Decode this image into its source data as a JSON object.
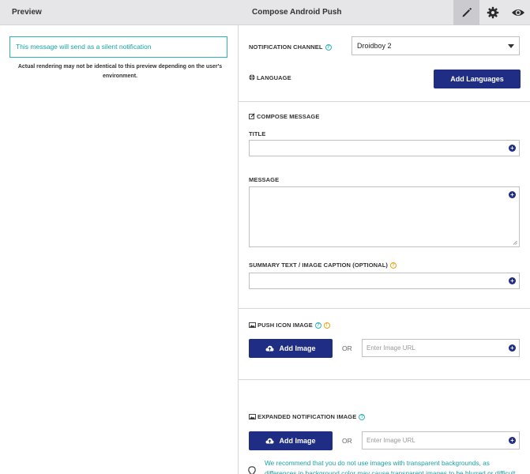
{
  "topbar": {
    "preview_title": "Preview",
    "compose_title": "Compose Android Push",
    "icons": [
      "pencil-icon",
      "gear-icon",
      "eye-icon"
    ]
  },
  "preview": {
    "silent_notice": "This message will send as a silent notification",
    "rendering_note": "Actual rendering may not be identical to this preview depending on the user's environment."
  },
  "channel": {
    "label": "NOTIFICATION CHANNEL",
    "selected": "Droidboy 2"
  },
  "language": {
    "label": "LANGUAGE",
    "add_button": "Add Languages"
  },
  "compose": {
    "header": "COMPOSE MESSAGE",
    "title_label": "TITLE",
    "title_value": "",
    "message_label": "MESSAGE",
    "message_value": "",
    "summary_label": "SUMMARY TEXT / IMAGE CAPTION (OPTIONAL)",
    "summary_value": ""
  },
  "push_icon": {
    "label": "PUSH ICON IMAGE",
    "add_button": "Add Image",
    "or": "OR",
    "url_placeholder": "Enter Image URL"
  },
  "expanded": {
    "label": "EXPANDED NOTIFICATION IMAGE",
    "add_button": "Add Image",
    "or": "OR",
    "url_placeholder": "Enter Image URL",
    "tip": "We recommend that you do not use images with transparent backgrounds, as differences in background color may cause transparent images to be blurred or difficult to see on some devices."
  },
  "colors": {
    "primary": "#1f2d85",
    "teal": "#1aa3a6",
    "warning": "#e8a317",
    "topbar": "#e6e6e8"
  }
}
